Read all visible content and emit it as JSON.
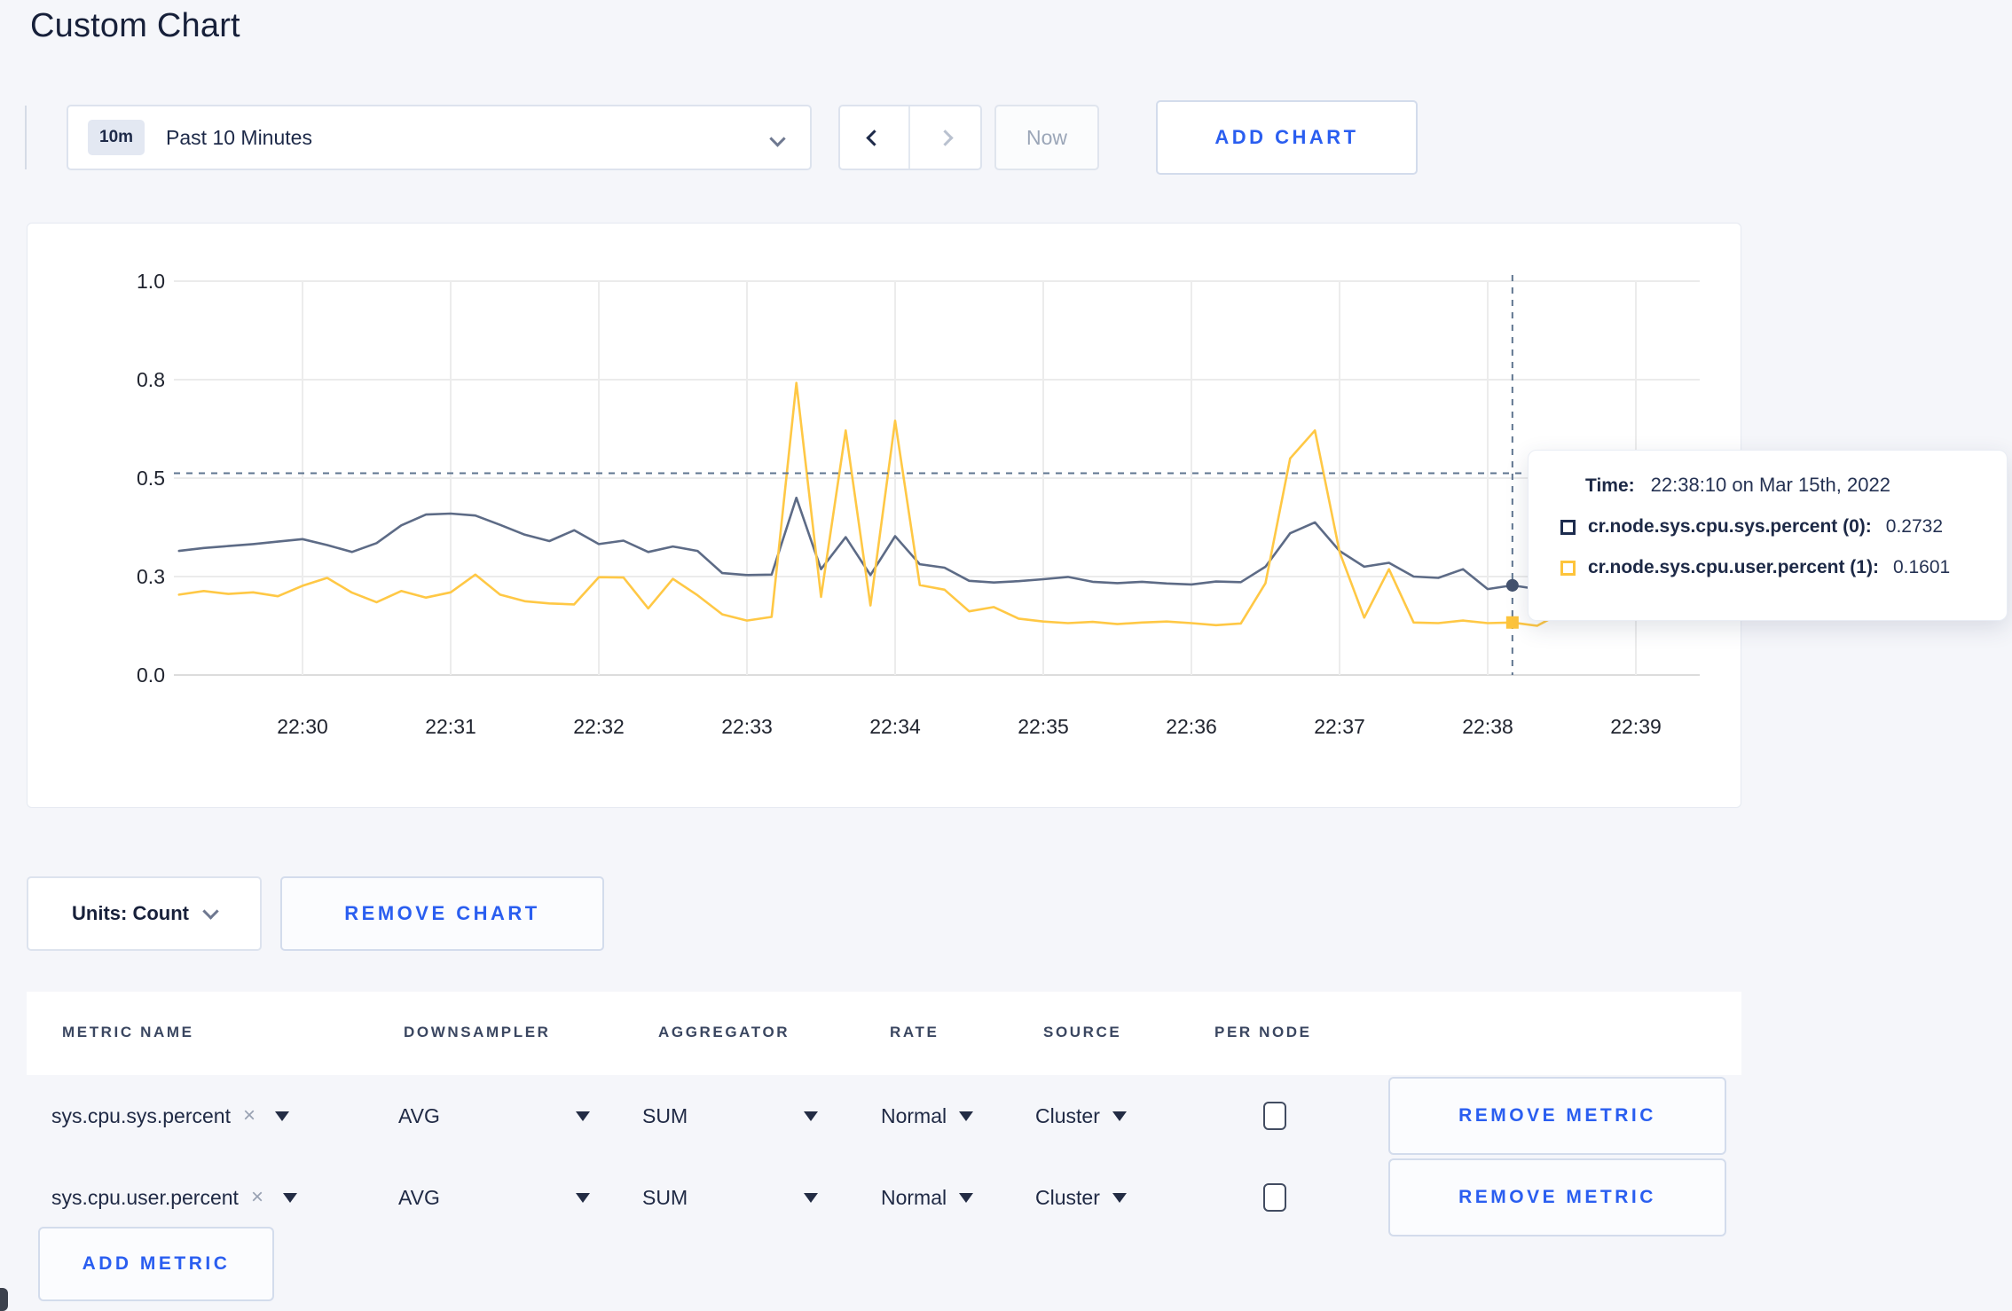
{
  "page": {
    "title": "Custom Chart"
  },
  "toolbar": {
    "range_badge": "10m",
    "range_label": "Past 10 Minutes",
    "now_label": "Now",
    "add_chart_label": "ADD CHART"
  },
  "chart_data": {
    "type": "line",
    "title": "",
    "xlabel": "",
    "ylabel": "",
    "grid": true,
    "legend_position": "tooltip",
    "x_tick_labels": [
      "22:30",
      "22:31",
      "22:32",
      "22:33",
      "22:34",
      "22:35",
      "22:36",
      "22:37",
      "22:38",
      "22:39"
    ],
    "y_ticks": [
      0.0,
      0.3,
      0.5,
      0.8,
      1.0
    ],
    "y_tick_labels": [
      "0.0",
      "0.3",
      "0.5",
      "0.8",
      "1.0"
    ],
    "start_time": "22:29:10",
    "interval_seconds": 10,
    "series": [
      {
        "name": "cr.node.sys.cpu.sys.percent",
        "color": "#5d6b86",
        "values": [
          0.352,
          0.358,
          0.362,
          0.366,
          0.371,
          0.376,
          0.364,
          0.35,
          0.368,
          0.404,
          0.426,
          0.428,
          0.424,
          0.405,
          0.385,
          0.372,
          0.394,
          0.366,
          0.373,
          0.35,
          0.361,
          0.352,
          0.307,
          0.303,
          0.304,
          0.46,
          0.315,
          0.38,
          0.303,
          0.382,
          0.325,
          0.318,
          0.287,
          0.282,
          0.286,
          0.292,
          0.299,
          0.284,
          0.28,
          0.284,
          0.279,
          0.276,
          0.285,
          0.283,
          0.32,
          0.388,
          0.41,
          0.352,
          0.32,
          0.328,
          0.3,
          0.296,
          0.315,
          0.262,
          0.2732,
          0.262,
          0.27,
          0.29,
          0.308,
          0.3,
          0.314,
          0.33
        ]
      },
      {
        "name": "cr.node.sys.cpu.user.percent",
        "color": "#ffc845",
        "values": [
          0.245,
          0.256,
          0.247,
          0.252,
          0.24,
          0.272,
          0.296,
          0.251,
          0.222,
          0.256,
          0.236,
          0.252,
          0.304,
          0.245,
          0.225,
          0.218,
          0.215,
          0.298,
          0.297,
          0.203,
          0.293,
          0.243,
          0.185,
          0.166,
          0.177,
          0.79,
          0.238,
          0.645,
          0.212,
          0.675,
          0.274,
          0.26,
          0.194,
          0.207,
          0.172,
          0.163,
          0.158,
          0.162,
          0.155,
          0.16,
          0.163,
          0.158,
          0.152,
          0.157,
          0.28,
          0.56,
          0.645,
          0.35,
          0.175,
          0.315,
          0.16,
          0.158,
          0.166,
          0.158,
          0.1601,
          0.15,
          0.19,
          0.25,
          0.285,
          0.275,
          0.21,
          0.27
        ]
      }
    ],
    "crosshair": {
      "time": "22:38:10",
      "point_index": 54,
      "hover_y_value": 0.515,
      "marker_values": [
        0.2732,
        0.1601
      ]
    }
  },
  "tooltip": {
    "time_label": "Time:",
    "time_value": "22:38:10 on Mar 15th, 2022",
    "rows": [
      {
        "name": "cr.node.sys.cpu.sys.percent (0):",
        "value": "0.2732",
        "swatch_color": "#1d2c4e"
      },
      {
        "name": "cr.node.sys.cpu.user.percent (1):",
        "value": "0.1601",
        "swatch_color": "#fdc43c"
      }
    ]
  },
  "chart_controls": {
    "units_label": "Units: Count",
    "remove_chart_label": "REMOVE CHART"
  },
  "metric_table": {
    "headers": [
      "METRIC NAME",
      "DOWNSAMPLER",
      "AGGREGATOR",
      "RATE",
      "SOURCE",
      "PER NODE"
    ],
    "rows": [
      {
        "metric_name": "sys.cpu.sys.percent",
        "downsampler": "AVG",
        "aggregator": "SUM",
        "rate": "Normal",
        "source": "Cluster",
        "per_node_checked": false,
        "remove_label": "REMOVE METRIC"
      },
      {
        "metric_name": "sys.cpu.user.percent",
        "downsampler": "AVG",
        "aggregator": "SUM",
        "rate": "Normal",
        "source": "Cluster",
        "per_node_checked": false,
        "remove_label": "REMOVE METRIC"
      }
    ],
    "add_metric_label": "ADD METRIC"
  },
  "colors": {
    "accent_blue": "#2a5ef0",
    "page_background": "#f5f6fa",
    "crosshair": "#5f7590"
  }
}
